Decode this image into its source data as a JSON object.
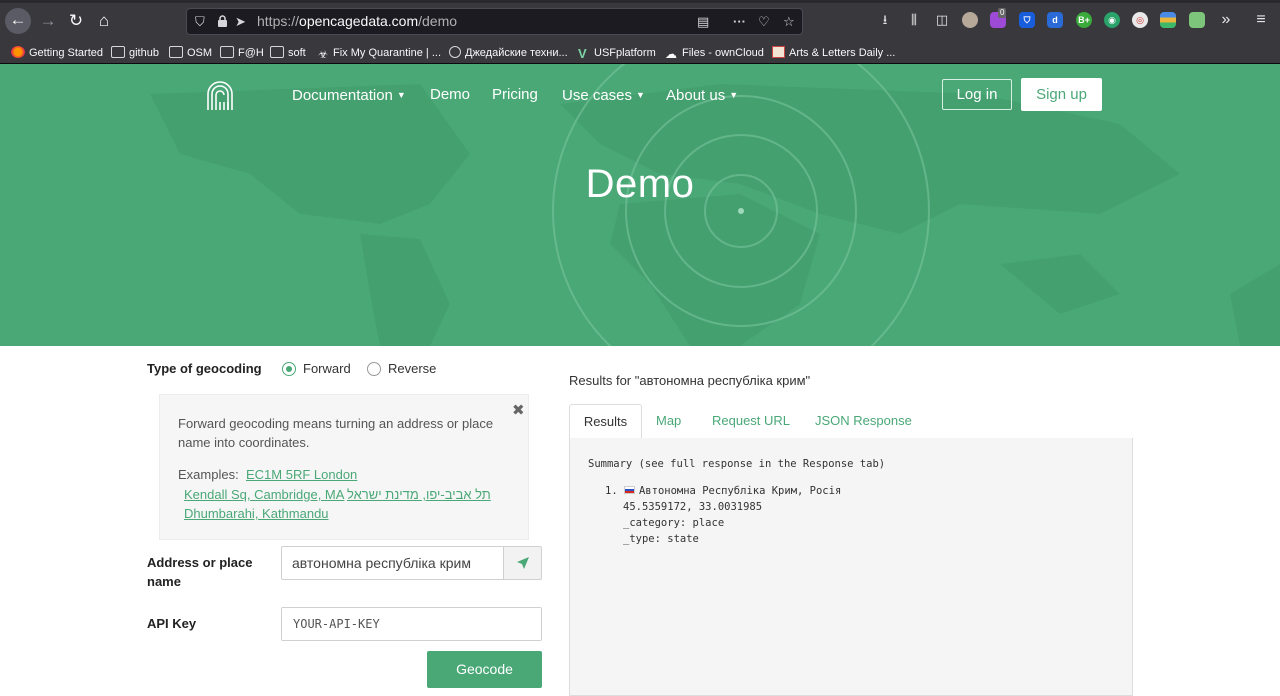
{
  "browser": {
    "url_prefix": "https://",
    "url_domain": "opencagedata.com",
    "url_path": "/demo",
    "extension_badge": "0",
    "bookmarks": [
      {
        "label": "Getting Started",
        "icon": "firefox-icon"
      },
      {
        "label": "github",
        "icon": "folder-icon"
      },
      {
        "label": "OSM",
        "icon": "folder-icon"
      },
      {
        "label": "F@H",
        "icon": "folder-icon"
      },
      {
        "label": "soft",
        "icon": "folder-icon"
      },
      {
        "label": "Fix My Quarantine | ...",
        "icon": "biohazard-icon"
      },
      {
        "label": "Джедайские техни...",
        "icon": "globe-icon"
      },
      {
        "label": "USFplatform",
        "icon": "v-logo-icon"
      },
      {
        "label": "Files - ownCloud",
        "icon": "cloud-icon"
      },
      {
        "label": "Arts & Letters Daily ...",
        "icon": "page-icon"
      }
    ]
  },
  "site": {
    "nav": [
      {
        "label": "Documentation",
        "dropdown": true
      },
      {
        "label": "Demo",
        "dropdown": false
      },
      {
        "label": "Pricing",
        "dropdown": false
      },
      {
        "label": "Use cases",
        "dropdown": true
      },
      {
        "label": "About us",
        "dropdown": true
      }
    ],
    "login_label": "Log in",
    "signup_label": "Sign up",
    "hero_title": "Demo",
    "brand_color": "#4aa877"
  },
  "form": {
    "geocoding_type_label": "Type of geocoding",
    "forward_label": "Forward",
    "reverse_label": "Reverse",
    "selected_type": "Forward",
    "info_text": "Forward geocoding means turning an address or place name into coordinates.",
    "examples_label": "Examples:",
    "examples": [
      "EC1M 5RF London",
      "Kendall Sq, Cambridge, MA",
      "תל אביב-יפו, מדינת ישראל",
      "Dhumbarahi, Kathmandu"
    ],
    "close_glyph": "✖",
    "address_label": "Address or place name",
    "address_value": "автономна республіка крим",
    "api_key_label": "API Key",
    "api_key_value": "YOUR-API-KEY",
    "geocode_button": "Geocode"
  },
  "results": {
    "title": "Results for \"автономна республіка крим\"",
    "tabs": [
      "Results",
      "Map",
      "Request URL",
      "JSON Response"
    ],
    "active_tab": "Results",
    "summary_header": "Summary (see full response in the Response tab)",
    "items": [
      {
        "index": "1.",
        "name": "Автономна Республіка Крим, Росія",
        "coords": "45.5359172, 33.0031985",
        "category": "_category: place",
        "type": "_type: state"
      }
    ]
  }
}
